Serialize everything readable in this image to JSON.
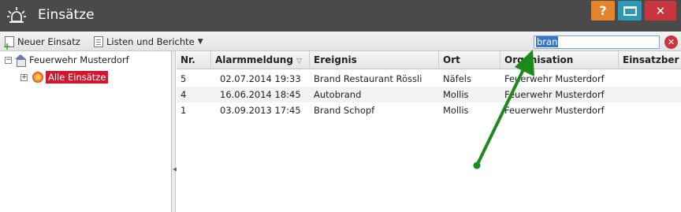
{
  "window": {
    "title": "Einsätze",
    "help_label": "?",
    "close_label": "✕"
  },
  "toolbar": {
    "new_label": "Neuer Einsatz",
    "lists_label": "Listen und Berichte",
    "search_value": "bran",
    "clear_label": "✕"
  },
  "tree": {
    "root_label": "Feuerwehr Musterdorf",
    "child_label": "Alle Einsätze"
  },
  "grid": {
    "columns": [
      "Nr.",
      "Alarmmeldung",
      "Ereignis",
      "Ort",
      "Organisation",
      "Einsatzber"
    ],
    "rows": [
      [
        "5",
        "02.07.2014 19:33",
        "Brand Restaurant Rössli",
        "Näfels",
        "Feuerwehr Musterdorf",
        ""
      ],
      [
        "4",
        "16.06.2014 18:45",
        "Autobrand",
        "Mollis",
        "Feuerwehr Musterdorf",
        ""
      ],
      [
        "1",
        "03.09.2013 17:45",
        "Brand Schopf",
        "Mollis",
        "Feuerwehr Musterdorf",
        ""
      ]
    ]
  },
  "colors": {
    "titlebar": "#4a4a4a",
    "help": "#e4842b",
    "maximize": "#2e98b8",
    "close": "#c9343e",
    "selected_tree": "#d2182f",
    "annotation_arrow": "#1a8a1a"
  },
  "icons": [
    "siren-icon",
    "new-document-icon",
    "list-document-icon",
    "clear-search-icon",
    "house-icon",
    "flame-icon",
    "sort-icon"
  ]
}
